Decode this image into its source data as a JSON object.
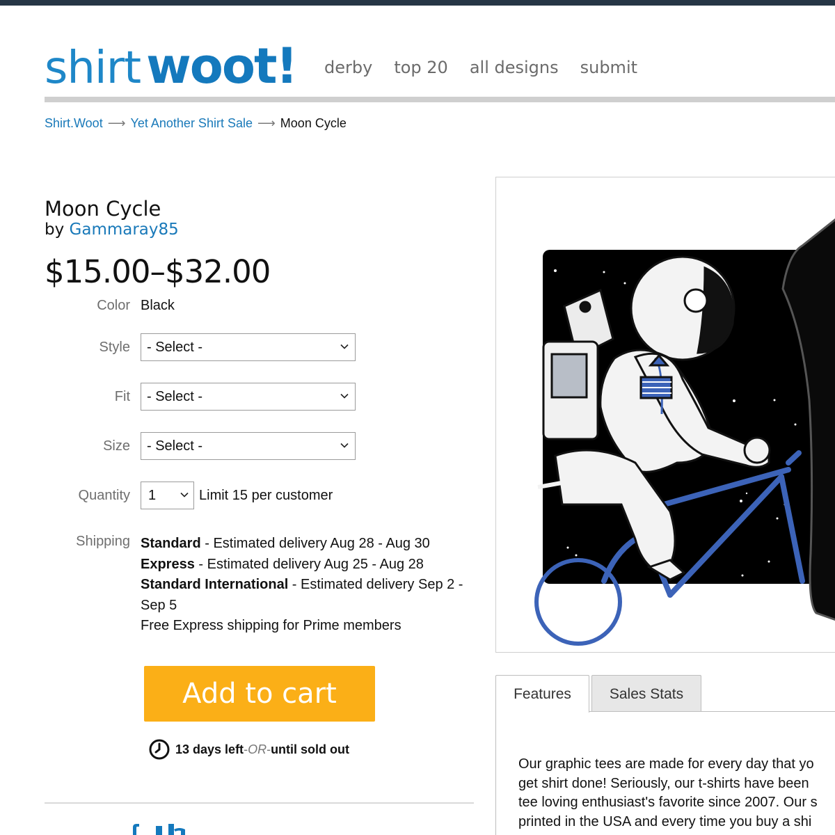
{
  "brand": {
    "shirt": "shirt",
    "woot": "woot!"
  },
  "nav": {
    "items": [
      "derby",
      "top 20",
      "all designs",
      "submit"
    ]
  },
  "breadcrumb": {
    "items": [
      "Shirt.Woot",
      "Yet Another Shirt Sale",
      "Moon Cycle"
    ],
    "separator": "⟶"
  },
  "product": {
    "title": "Moon Cycle",
    "by_label": "by",
    "author": "Gammaray85",
    "price": "$15.00–$32.00"
  },
  "options": {
    "color_label": "Color",
    "color_value": "Black",
    "style_label": "Style",
    "style_value": "- Select -",
    "fit_label": "Fit",
    "fit_value": "- Select -",
    "size_label": "Size",
    "size_value": "- Select -",
    "quantity_label": "Quantity",
    "quantity_value": "1",
    "quantity_limit": "Limit 15 per customer"
  },
  "shipping": {
    "label": "Shipping",
    "standard_name": "Standard",
    "standard_text": " - Estimated delivery Aug 28 - Aug 30",
    "express_name": "Express",
    "express_text": " - Estimated delivery Aug 25 - Aug 28",
    "intl_name": "Standard International",
    "intl_text": " - Estimated delivery Sep 2 - Sep 5",
    "prime_note": "Free Express shipping for Prime members"
  },
  "cart": {
    "button_label": "Add to cart"
  },
  "timer": {
    "days_left": "13 days left",
    "dash1": " - ",
    "or_text": "OR",
    "dash2": " - ",
    "sold_out": "until sold out"
  },
  "tabs": {
    "features": "Features",
    "sales_stats": "Sales Stats"
  },
  "features": {
    "lines": [
      "Our graphic tees are made for every day that yo",
      "get shirt done! Seriously, our t-shirts have been",
      "tee loving enthusiast's favorite since 2007. Our s",
      "printed in the USA and every time you buy a shi"
    ]
  },
  "colors": {
    "brand_blue": "#1979b9",
    "cart_orange": "#fbaf17",
    "topbar": "#263645"
  }
}
